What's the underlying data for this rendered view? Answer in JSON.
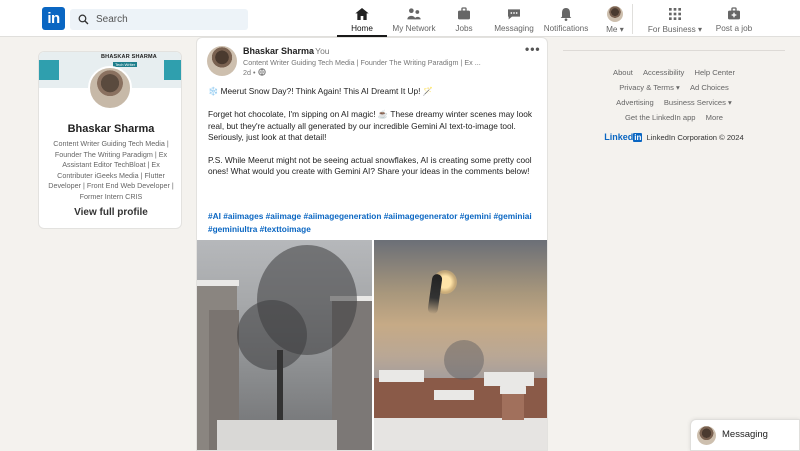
{
  "nav": {
    "logo": "in",
    "search_placeholder": "Search",
    "items": [
      {
        "label": "Home",
        "icon": "home-icon",
        "active": true
      },
      {
        "label": "My Network",
        "icon": "network-icon",
        "active": false
      },
      {
        "label": "Jobs",
        "icon": "jobs-icon",
        "active": false
      },
      {
        "label": "Messaging",
        "icon": "messaging-icon",
        "active": false
      },
      {
        "label": "Notifications",
        "icon": "bell-icon",
        "active": false
      },
      {
        "label": "Me",
        "icon": "avatar",
        "active": false
      },
      {
        "label": "For Business",
        "icon": "grid-icon",
        "active": false
      },
      {
        "label": "Post a job",
        "icon": "briefcase-plus-icon",
        "active": false
      }
    ]
  },
  "profile": {
    "name": "Bhaskar Sharma",
    "headline": "Content Writer Guiding Tech Media | Founder The Writing Paradigm | Ex Assistant Editor TechBloat | Ex Contributer iGeeks Media | Flutter Developer | Front End Web Developer | Former Intern CRIS",
    "view_profile": "View full profile",
    "banner_title": "BHASKAR SHARMA",
    "banner_sub": "Tech Writer"
  },
  "post": {
    "author": "Bhaskar Sharma",
    "you": "• You",
    "headline": "Content Writer Guiding Tech Media | Founder The Writing Paradigm | Ex ...",
    "time": "2d •",
    "more": "•••",
    "title": "❄️ Meerut Snow Day?! Think Again! This AI Dreamt It Up! 🪄",
    "para1": "Forget hot chocolate, I'm sipping on AI magic! ☕ These dreamy winter scenes may look real, but they're actually all generated by our incredible Gemini AI text-to-image tool. Seriously, just look at that detail!",
    "para2": "P.S. While Meerut might not be seeing actual snowflakes, AI is creating some pretty cool ones! What would you create with Gemini AI? Share your ideas in the comments below!",
    "hashtags": "#AI #aiimages #aiimage #aiimagegeneration #aiimagegenerator #gemini #geminiai #geminiultra #texttoimage"
  },
  "footer": {
    "row1": [
      "About",
      "Accessibility",
      "Help Center"
    ],
    "row2": [
      "Privacy & Terms ▾",
      "Ad Choices"
    ],
    "row3": [
      "Advertising",
      "Business Services ▾"
    ],
    "row4": [
      "Get the LinkedIn app",
      "More"
    ],
    "brand": "Linked",
    "brand_in": "in",
    "copyright": "LinkedIn Corporation © 2024"
  },
  "messaging": {
    "label": "Messaging"
  },
  "colors": {
    "brand": "#0a66c2",
    "background": "#f4f2ee"
  }
}
